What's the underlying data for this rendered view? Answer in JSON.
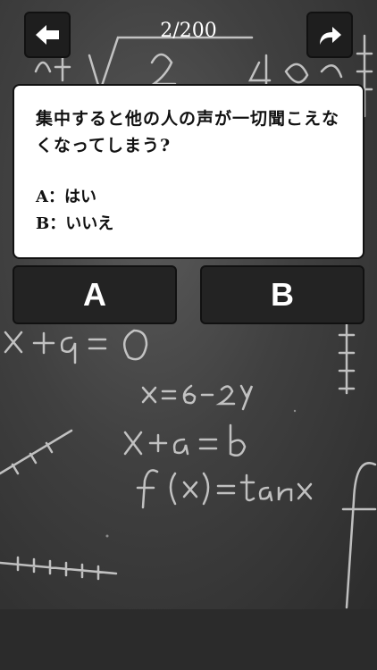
{
  "header": {
    "counter": "2/200",
    "back_icon": "arrow-left-icon",
    "share_icon": "share-arrow-icon"
  },
  "question": {
    "text": "集中すると他の人の声が一切聞こえなくなってしまう?",
    "options": [
      "A：はい",
      "B：いいえ"
    ]
  },
  "answers": {
    "a_label": "A",
    "b_label": "B"
  },
  "colors": {
    "board": "#3f3f3f",
    "button": "#232323",
    "card": "#ffffff"
  }
}
